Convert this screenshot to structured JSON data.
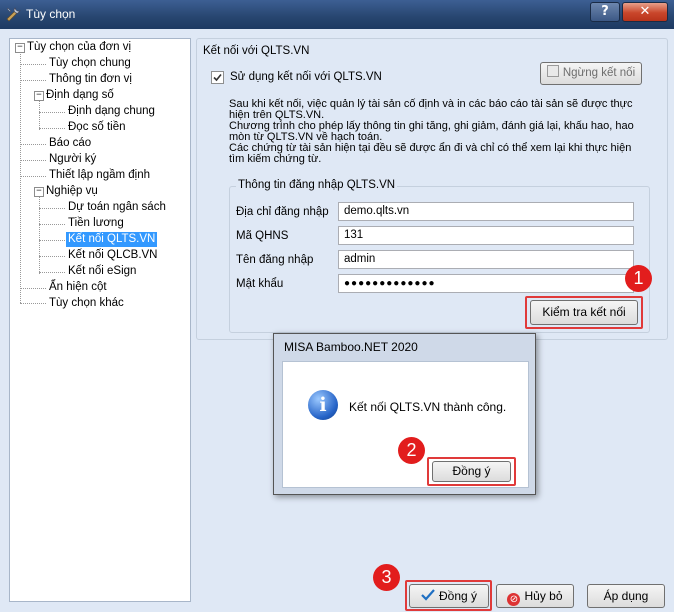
{
  "window": {
    "title": "Tùy chọn",
    "help_label": "?",
    "close_label": "✕"
  },
  "tree": {
    "root": "Tùy chọn của đơn vị",
    "items": [
      "Tùy chọn chung",
      "Thông tin đơn vị",
      "Định dạng số",
      "Định dạng chung",
      "Đọc số tiền",
      "Báo cáo",
      "Người ký",
      "Thiết lập ngầm định",
      "Nghiệp vụ",
      "Dự toán ngân sách",
      "Tiền lương",
      "Kết nối QLTS.VN",
      "Kết nối QLCB.VN",
      "Kết nối eSign",
      "Ẩn hiện cột",
      "Tùy chọn khác"
    ],
    "selected": "Kết nối QLTS.VN"
  },
  "panel": {
    "title": "Kết nối với QLTS.VN",
    "use_connection_label": "Sử dụng kết nối với QLTS.VN",
    "use_connection_checked": true,
    "disconnect_label": "Ngừng kết nối",
    "description_lines": [
      "Sau khi kết nối, việc quản lý tài sản cố định và in các báo cáo tài sản sẽ được thực",
      "hiện trên QLTS.VN.",
      "Chương trình cho phép lấy thông tin ghi tăng, ghi giảm, đánh giá lại, khấu hao, hao",
      "mòn từ QLTS.VN về hạch toán.",
      "Các chứng từ tài sản hiện tại đều sẽ được ẩn đi và chỉ có thể xem lại khi thực hiện",
      "tìm kiếm chứng từ."
    ],
    "login_group_title": "Thông tin đăng nhập QLTS.VN",
    "fields": {
      "address_label": "Địa chỉ đăng nhập",
      "address_value": "demo.qlts.vn",
      "qhns_label": "Mã QHNS",
      "qhns_value": "131",
      "username_label": "Tên đăng nhập",
      "username_value": "admin",
      "password_label": "Mật khẩu",
      "password_value": "●●●●●●●●●●●●●"
    },
    "test_connection_label": "Kiểm tra kết nối"
  },
  "dialog": {
    "title": "MISA Bamboo.NET 2020",
    "message": "Kết nối QLTS.VN thành công.",
    "ok_label": "Đồng ý"
  },
  "footer": {
    "ok_label": "Đồng ý",
    "cancel_label": "Hủy bỏ",
    "apply_label": "Áp dụng"
  },
  "annotations": {
    "step1": "1",
    "step2": "2",
    "step3": "3",
    "highlight_color": "#e03a3a"
  }
}
